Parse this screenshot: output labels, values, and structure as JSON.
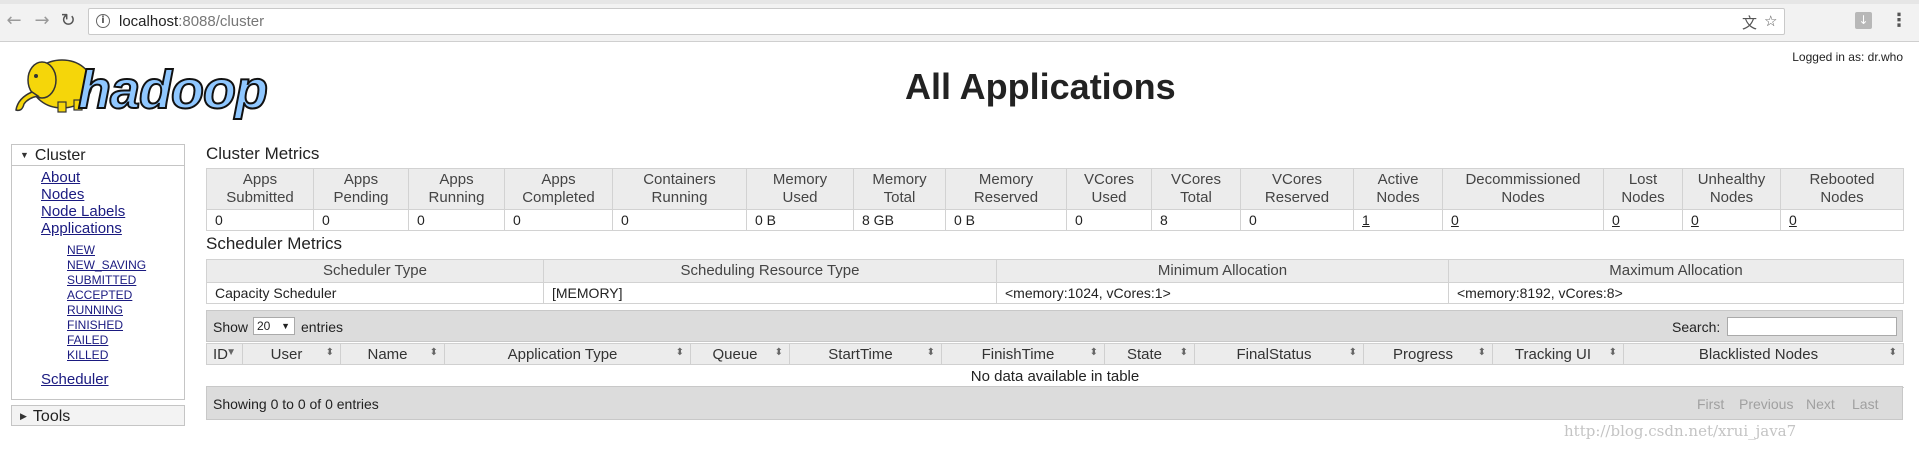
{
  "browser": {
    "url_host": "localhost",
    "url_port": ":8088",
    "url_path": "/cluster"
  },
  "header": {
    "logo_text": "hadoop",
    "title": "All Applications",
    "login": "Logged in as: dr.who"
  },
  "sidebar": {
    "cluster_label": "Cluster",
    "links": [
      "About",
      "Nodes",
      "Node Labels",
      "Applications"
    ],
    "app_states": [
      "NEW",
      "NEW_SAVING",
      "SUBMITTED",
      "ACCEPTED",
      "RUNNING",
      "FINISHED",
      "FAILED",
      "KILLED"
    ],
    "scheduler_link": "Scheduler",
    "tools_label": "Tools"
  },
  "cluster_metrics": {
    "title": "Cluster Metrics",
    "headers": [
      [
        "Apps",
        "Submitted"
      ],
      [
        "Apps",
        "Pending"
      ],
      [
        "Apps",
        "Running"
      ],
      [
        "Apps",
        "Completed"
      ],
      [
        "Containers",
        "Running"
      ],
      [
        "Memory",
        "Used"
      ],
      [
        "Memory",
        "Total"
      ],
      [
        "Memory",
        "Reserved"
      ],
      [
        "VCores",
        "Used"
      ],
      [
        "VCores",
        "Total"
      ],
      [
        "VCores",
        "Reserved"
      ],
      [
        "Active",
        "Nodes"
      ],
      [
        "Decommissioned",
        "Nodes"
      ],
      [
        "Lost",
        "Nodes"
      ],
      [
        "Unhealthy",
        "Nodes"
      ],
      [
        "Rebooted",
        "Nodes"
      ]
    ],
    "values": [
      "0",
      "0",
      "0",
      "0",
      "0",
      "0 B",
      "8 GB",
      "0 B",
      "0",
      "8",
      "0",
      "1",
      "0",
      "0",
      "0",
      "0"
    ],
    "linked": [
      false,
      false,
      false,
      false,
      false,
      false,
      false,
      false,
      false,
      false,
      false,
      true,
      true,
      true,
      true,
      true
    ]
  },
  "scheduler_metrics": {
    "title": "Scheduler Metrics",
    "headers": [
      "Scheduler Type",
      "Scheduling Resource Type",
      "Minimum Allocation",
      "Maximum Allocation"
    ],
    "values": [
      "Capacity Scheduler",
      "[MEMORY]",
      "<memory:1024, vCores:1>",
      "<memory:8192, vCores:8>"
    ]
  },
  "apps_table": {
    "show_label": "Show",
    "entries_value": "20",
    "entries_label": "entries",
    "search_label": "Search:",
    "search_value": "",
    "columns": [
      "ID",
      "User",
      "Name",
      "Application Type",
      "Queue",
      "StartTime",
      "FinishTime",
      "State",
      "FinalStatus",
      "Progress",
      "Tracking UI",
      "Blacklisted Nodes"
    ],
    "empty_message": "No data available in table",
    "footer_info": "Showing 0 to 0 of 0 entries",
    "pager": [
      "First",
      "Previous",
      "Next",
      "Last"
    ]
  },
  "watermark": "http://blog.csdn.net/xrui_java7",
  "colors": {
    "link": "#1a1a80",
    "header_bg": "#ececec",
    "toolbar_bg": "#dcdcdc",
    "elephant": "#f5d60a",
    "logo_text": "#8fc7ff"
  }
}
